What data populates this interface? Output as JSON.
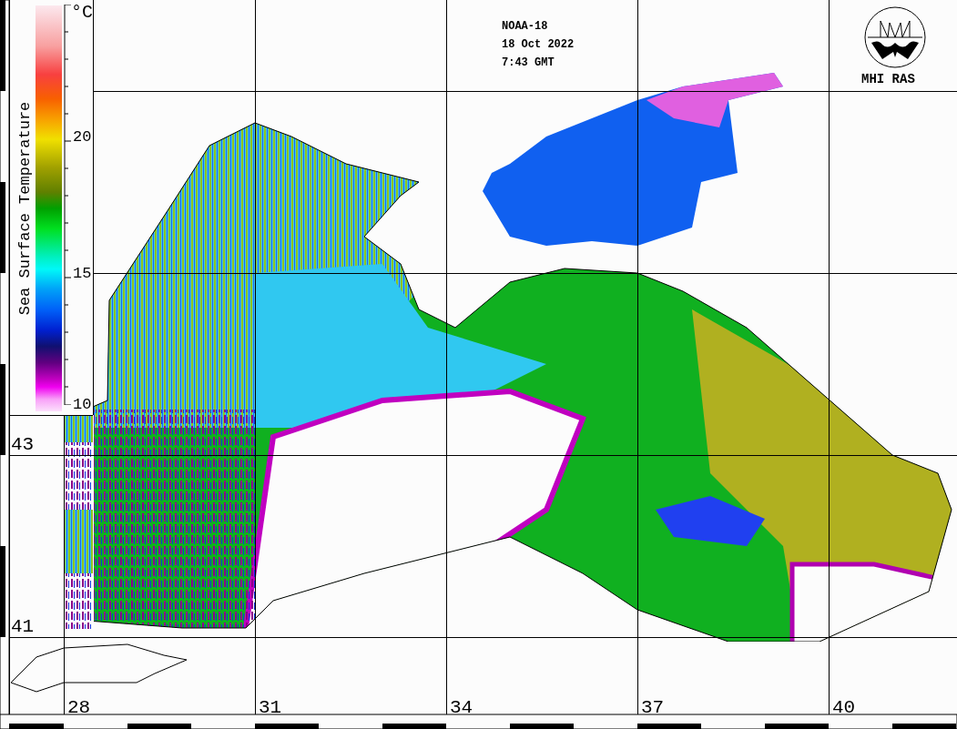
{
  "header": {
    "satellite": "NOAA-18",
    "date": "18 Oct 2022",
    "time": "7:43 GMT"
  },
  "logo": {
    "label": "MHI RAS"
  },
  "colorbar": {
    "title": "Sea Surface Temperature",
    "unit": "°C",
    "ticks": [
      "20",
      "15",
      "10"
    ]
  },
  "map": {
    "latitudes": [
      "43",
      "41"
    ],
    "longitudes": [
      "28",
      "31",
      "34",
      "37",
      "40"
    ]
  }
}
